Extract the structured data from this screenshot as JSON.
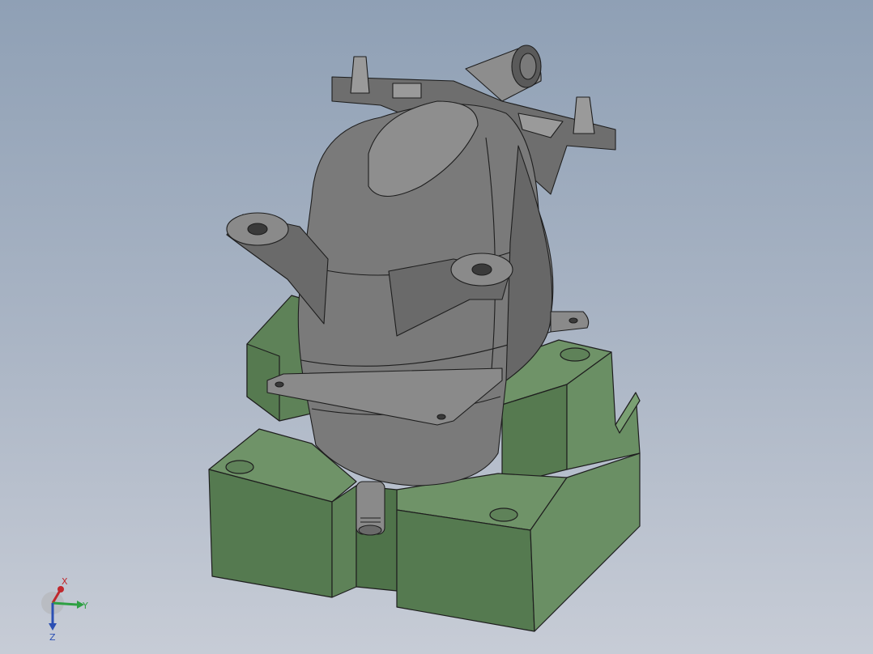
{
  "viewport": {
    "background_top": "#8fa0b5",
    "background_bottom": "#c7ccd6"
  },
  "model": {
    "tank_color": "#7a7a7a",
    "tank_shadow": "#5a5a5a",
    "fixture_color": "#6f9368",
    "fixture_dark": "#557a50",
    "edge_color": "#1e1e1e"
  },
  "triad": {
    "x_label": "X",
    "y_label": "Y",
    "z_label": "Z",
    "x_color": "#c0282d",
    "y_color": "#2ea043",
    "z_color": "#2b4fb3"
  }
}
